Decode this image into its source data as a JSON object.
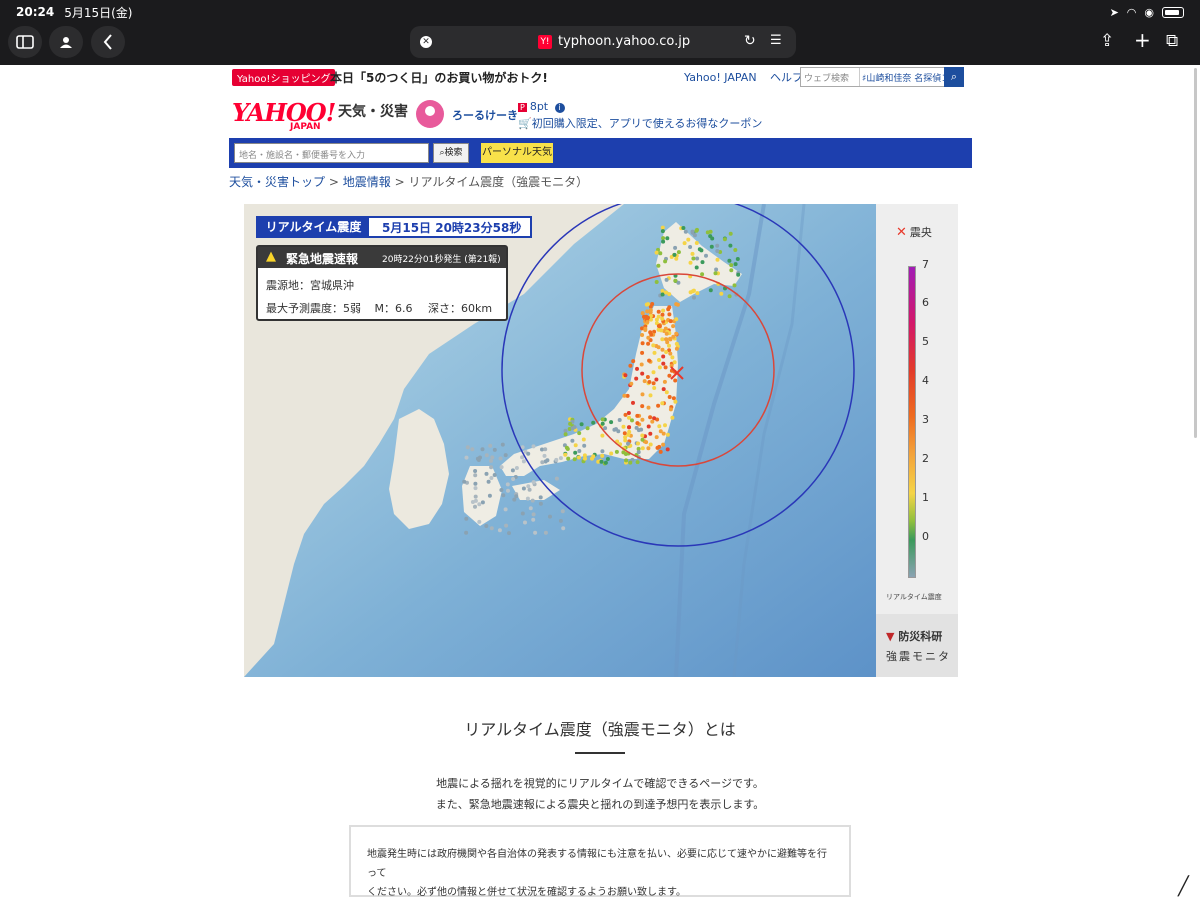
{
  "status": {
    "time": "20:24",
    "date": "5月15日(金)"
  },
  "browser": {
    "host": "typhoon.yahoo.co.jp",
    "favicon": "Y!"
  },
  "promo": {
    "tag": "Yahoo!ショッピング",
    "text": "本日「5のつく日」のお買い物がおトク!",
    "links": [
      "Yahoo! JAPAN",
      "ヘルプ"
    ],
    "search_placeholder": "ウェブ検索",
    "trend": "♯山崎和佳奈 名探偵コナン"
  },
  "header": {
    "logo": "YAHOO!",
    "logo_sub": "JAPAN",
    "service": "天気・災害",
    "user": "ろーるけーき",
    "points": "8pt",
    "coupon": "初回購入限定、アプリで使えるお得なクーポン"
  },
  "navbar": {
    "search_placeholder": "地名・施設名・郵便番号を入力",
    "search_button": "検索",
    "personal": "パーソナル天気"
  },
  "breadcrumb": {
    "items": [
      "天気・災害トップ",
      "地震情報"
    ],
    "current": "リアルタイム震度（強震モニタ）",
    "separator": ">"
  },
  "realtime": {
    "label": "リアルタイム震度",
    "datetime": "5月15日 20時23分58秒"
  },
  "eew": {
    "title": "緊急地震速報",
    "issued": "20時22分01秒発生 (第21報)",
    "epicenter_label": "震源地：",
    "epicenter": "宮城県沖",
    "max_intensity_label": "最大予測震度：",
    "max_intensity": "5弱",
    "magnitude_label": "M：",
    "magnitude": "6.6",
    "depth_label": "深さ：",
    "depth": "60km"
  },
  "legend": {
    "epicenter_label": "震央",
    "scale_caption": "リアルタイム震度",
    "ticks": [
      "7",
      "6",
      "5",
      "4",
      "3",
      "2",
      "1",
      "0"
    ],
    "provider": "防災科研",
    "provider_sub": "強震モニタ",
    "epicenter_color": "#e8382a"
  },
  "about": {
    "title": "リアルタイム震度（強震モニタ）とは",
    "desc1": "地震による揺れを視覚的にリアルタイムで確認できるページです。",
    "desc2": "また、緊急地震速報による震央と揺れの到達予想円を表示します。",
    "notice1": "地震発生時には政府機関や各自治体の発表する情報にも注意を払い、必要に応じて速やかに避難等を行って",
    "notice2": "ください。必ず他の情報と併せて状況を確認するようお願い致します。"
  }
}
